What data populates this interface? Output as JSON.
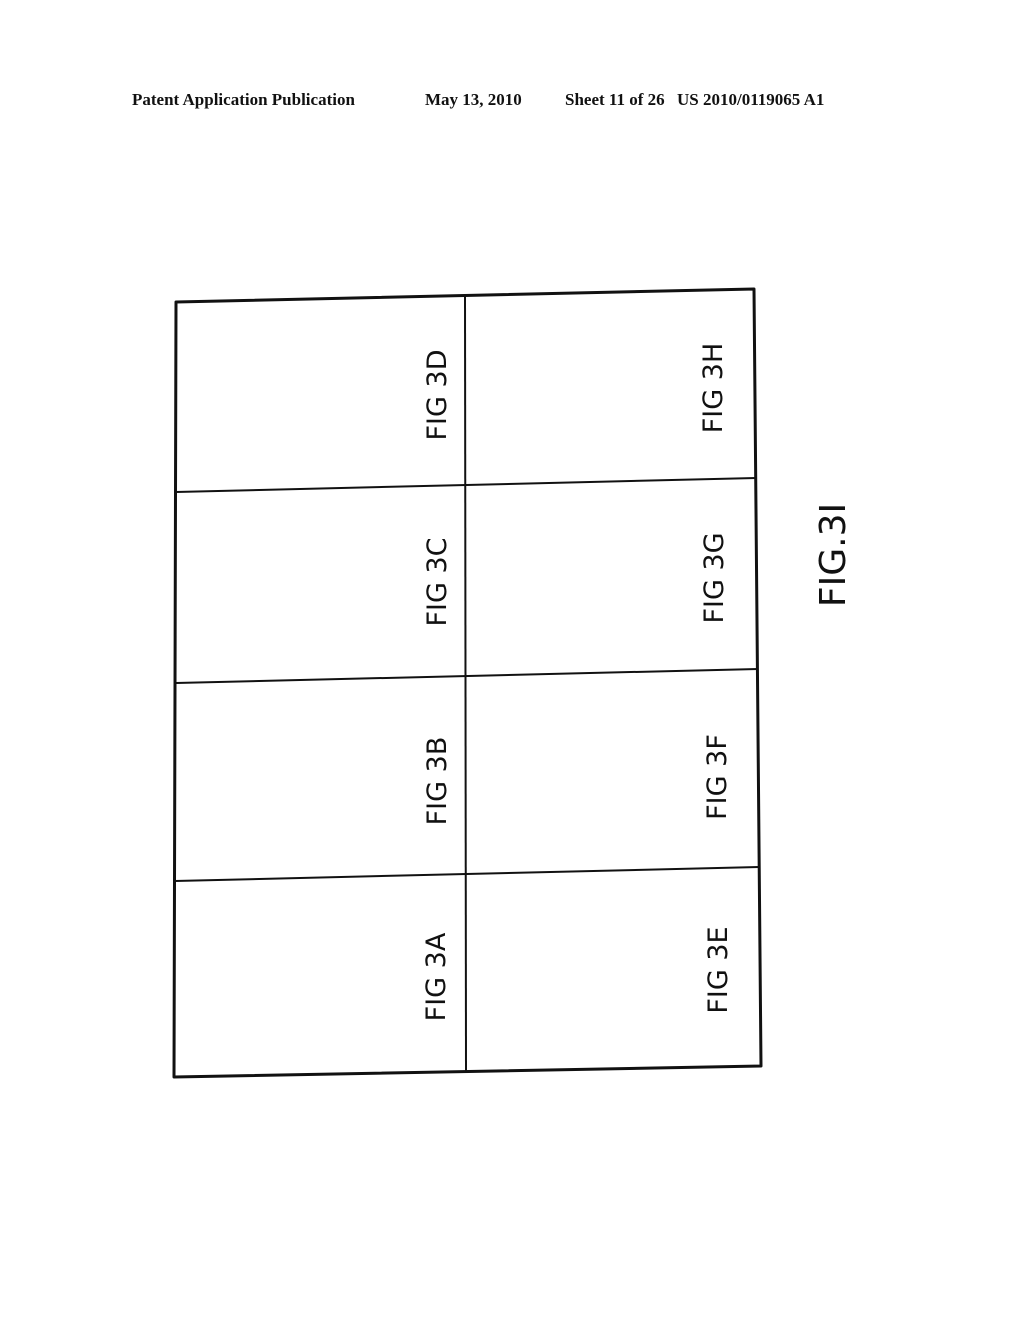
{
  "header": {
    "publication": "Patent Application Publication",
    "date": "May 13, 2010",
    "sheet": "Sheet 11 of 26",
    "number": "US 2010/0119065 A1"
  },
  "figure": {
    "caption": "FIG.3I",
    "description": "Layout diagram showing arrangement of sub-figures",
    "cells": [
      {
        "label": "FIG 3D",
        "row": 0,
        "col": 0
      },
      {
        "label": "FIG 3H",
        "row": 0,
        "col": 1
      },
      {
        "label": "FIG 3C",
        "row": 1,
        "col": 0
      },
      {
        "label": "FIG 3G",
        "row": 1,
        "col": 1
      },
      {
        "label": "FIG 3B",
        "row": 2,
        "col": 0
      },
      {
        "label": "FIG 3F",
        "row": 2,
        "col": 1
      },
      {
        "label": "FIG 3A",
        "row": 3,
        "col": 0
      },
      {
        "label": "FIG 3E",
        "row": 3,
        "col": 1
      }
    ]
  }
}
